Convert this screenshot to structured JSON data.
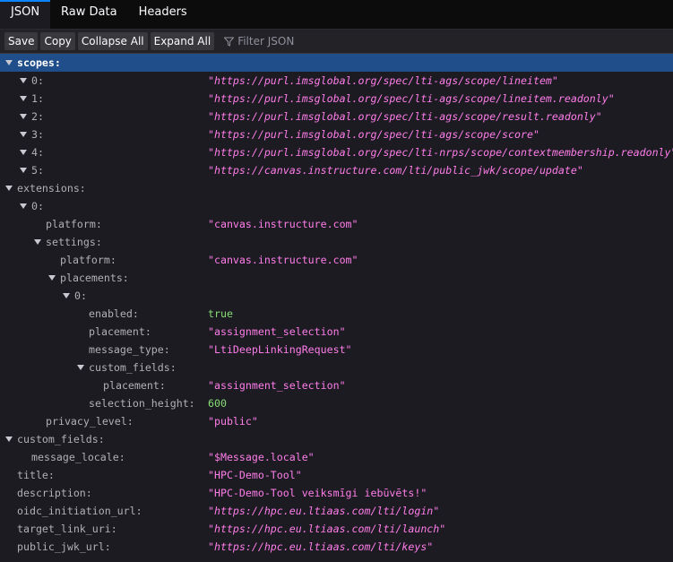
{
  "tabs": [
    {
      "label": "JSON",
      "active": true
    },
    {
      "label": "Raw Data",
      "active": false
    },
    {
      "label": "Headers",
      "active": false
    }
  ],
  "toolbar": {
    "save": "Save",
    "copy": "Copy",
    "collapse_all": "Collapse All",
    "expand_all": "Expand All",
    "filter_placeholder": "Filter JSON"
  },
  "rows": [
    {
      "depth": 0,
      "key": "scopes:",
      "expandable": true,
      "selected": true
    },
    {
      "depth": 1,
      "key": "0:",
      "expandable": true,
      "value": "\"https://purl.imsglobal.org/spec/lti-ags/scope/lineitem\"",
      "vtype": "url"
    },
    {
      "depth": 1,
      "key": "1:",
      "expandable": true,
      "value": "\"https://purl.imsglobal.org/spec/lti-ags/scope/lineitem.readonly\"",
      "vtype": "url"
    },
    {
      "depth": 1,
      "key": "2:",
      "expandable": true,
      "value": "\"https://purl.imsglobal.org/spec/lti-ags/scope/result.readonly\"",
      "vtype": "url"
    },
    {
      "depth": 1,
      "key": "3:",
      "expandable": true,
      "value": "\"https://purl.imsglobal.org/spec/lti-ags/scope/score\"",
      "vtype": "url"
    },
    {
      "depth": 1,
      "key": "4:",
      "expandable": true,
      "value": "\"https://purl.imsglobal.org/spec/lti-nrps/scope/contextmembership.readonly\"",
      "vtype": "url"
    },
    {
      "depth": 1,
      "key": "5:",
      "expandable": true,
      "value": "\"https://canvas.instructure.com/lti/public_jwk/scope/update\"",
      "vtype": "url"
    },
    {
      "depth": 0,
      "key": "extensions:",
      "expandable": true
    },
    {
      "depth": 1,
      "key": "0:",
      "expandable": true
    },
    {
      "depth": 2,
      "key": "platform:",
      "expandable": false,
      "value": "\"canvas.instructure.com\"",
      "vtype": "str"
    },
    {
      "depth": 2,
      "key": "settings:",
      "expandable": true
    },
    {
      "depth": 3,
      "key": "platform:",
      "expandable": false,
      "value": "\"canvas.instructure.com\"",
      "vtype": "str"
    },
    {
      "depth": 3,
      "key": "placements:",
      "expandable": true
    },
    {
      "depth": 4,
      "key": "0:",
      "expandable": true
    },
    {
      "depth": 5,
      "key": "enabled:",
      "expandable": false,
      "value": "true",
      "vtype": "bool"
    },
    {
      "depth": 5,
      "key": "placement:",
      "expandable": false,
      "value": "\"assignment_selection\"",
      "vtype": "str"
    },
    {
      "depth": 5,
      "key": "message_type:",
      "expandable": false,
      "value": "\"LtiDeepLinkingRequest\"",
      "vtype": "str"
    },
    {
      "depth": 5,
      "key": "custom_fields:",
      "expandable": true
    },
    {
      "depth": 6,
      "key": "placement:",
      "expandable": false,
      "value": "\"assignment_selection\"",
      "vtype": "str"
    },
    {
      "depth": 5,
      "key": "selection_height:",
      "expandable": false,
      "value": "600",
      "vtype": "num"
    },
    {
      "depth": 2,
      "key": "privacy_level:",
      "expandable": false,
      "value": "\"public\"",
      "vtype": "str"
    },
    {
      "depth": 0,
      "key": "custom_fields:",
      "expandable": true
    },
    {
      "depth": 1,
      "key": "message_locale:",
      "expandable": false,
      "value": "\"$Message.locale\"",
      "vtype": "str"
    },
    {
      "depth": 0,
      "key": "title:",
      "expandable": false,
      "value": "\"HPC-Demo-Tool\"",
      "vtype": "str"
    },
    {
      "depth": 0,
      "key": "description:",
      "expandable": false,
      "value": "\"HPC-Demo-Tool veiksmīgi iebūvēts!\"",
      "vtype": "str"
    },
    {
      "depth": 0,
      "key": "oidc_initiation_url:",
      "expandable": false,
      "value": "\"https://hpc.eu.ltiaas.com/lti/login\"",
      "vtype": "url"
    },
    {
      "depth": 0,
      "key": "target_link_uri:",
      "expandable": false,
      "value": "\"https://hpc.eu.ltiaas.com/lti/launch\"",
      "vtype": "url"
    },
    {
      "depth": 0,
      "key": "public_jwk_url:",
      "expandable": false,
      "value": "\"https://hpc.eu.ltiaas.com/lti/keys\"",
      "vtype": "url"
    }
  ]
}
